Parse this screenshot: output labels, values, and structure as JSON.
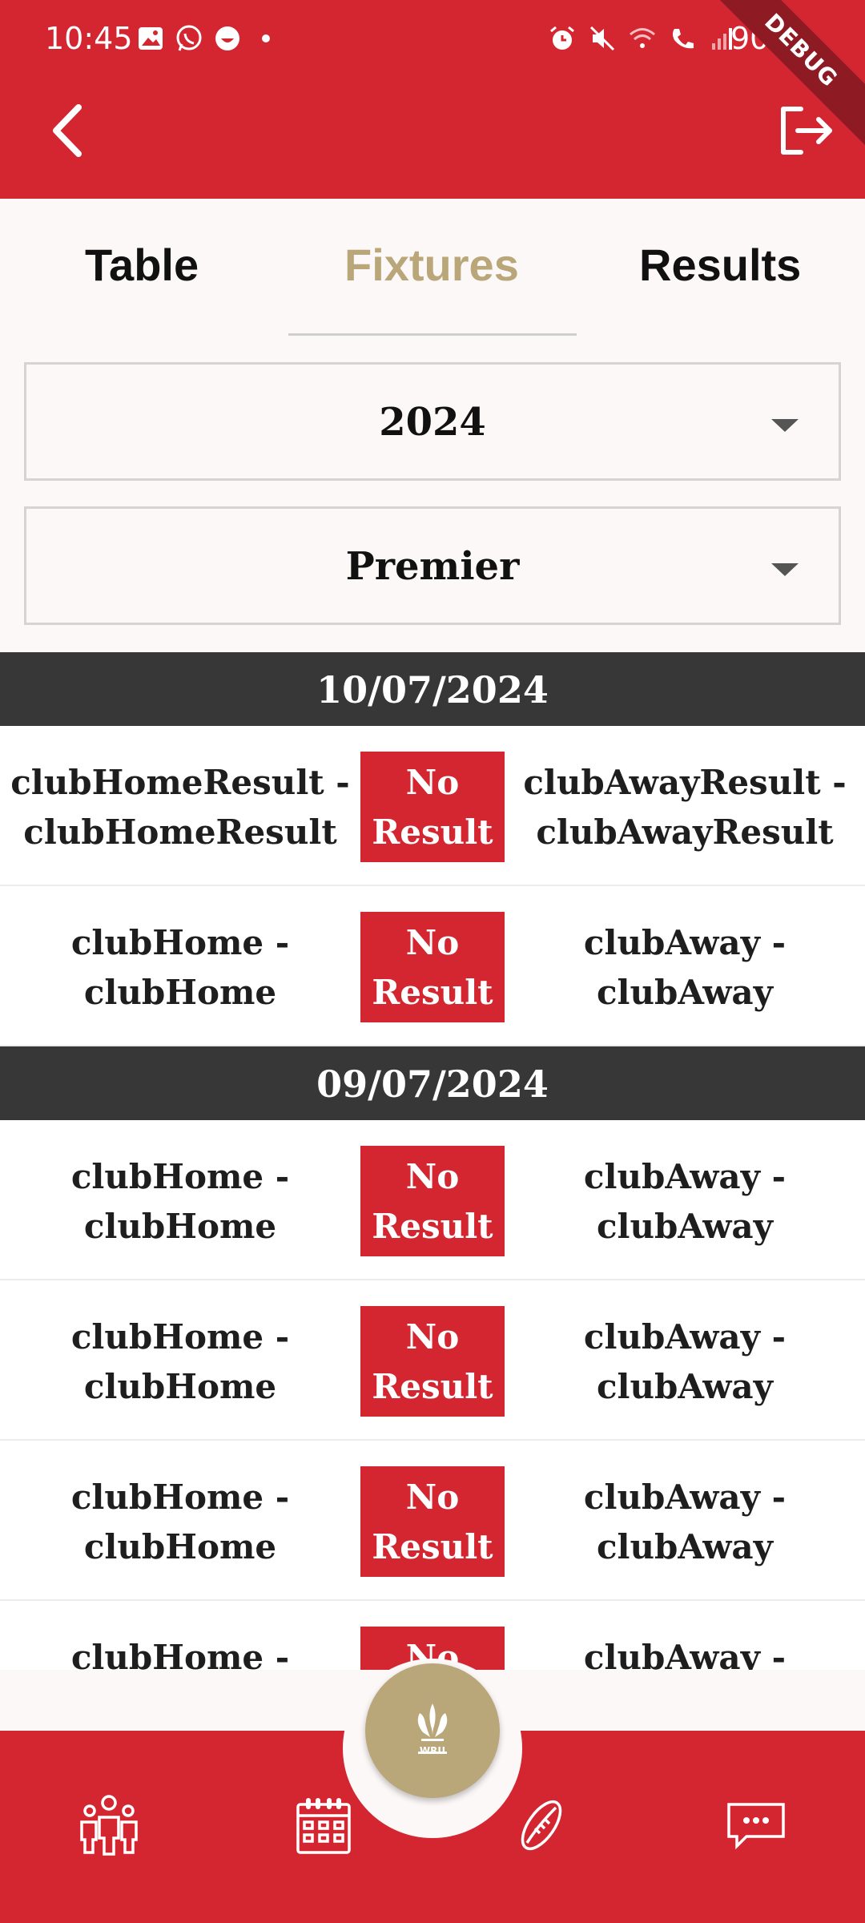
{
  "status_bar": {
    "time": "10:45",
    "battery": "90%",
    "debug_ribbon": "DEBUG",
    "left_icons": [
      "gallery-icon",
      "whatsapp-icon",
      "emoji-icon",
      "dot-icon"
    ],
    "right_icons": [
      "alarm-icon",
      "mute-icon",
      "wifi-icon",
      "wifi-call-icon",
      "signal-icon",
      "battery-icon"
    ]
  },
  "header": {
    "back_icon": "chevron-left-icon",
    "logout_icon": "logout-icon"
  },
  "tabs": [
    {
      "label": "Table",
      "active": false
    },
    {
      "label": "Fixtures",
      "active": true
    },
    {
      "label": "Results",
      "active": false
    }
  ],
  "filters": {
    "year": "2024",
    "league": "Premier"
  },
  "groups": [
    {
      "date": "10/07/2024",
      "matches": [
        {
          "home": "clubHomeResult - clubHomeResult",
          "status": "No Result",
          "away": "clubAwayResult - clubAwayResult"
        },
        {
          "home": "clubHome - clubHome",
          "status": "No Result",
          "away": "clubAway - clubAway"
        }
      ]
    },
    {
      "date": "09/07/2024",
      "matches": [
        {
          "home": "clubHome - clubHome",
          "status": "No Result",
          "away": "clubAway - clubAway"
        },
        {
          "home": "clubHome - clubHome",
          "status": "No Result",
          "away": "clubAway - clubAway"
        },
        {
          "home": "clubHome - clubHome",
          "status": "No Result",
          "away": "clubAway - clubAway"
        },
        {
          "home": "clubHome - clubHome",
          "status": "No Result",
          "away": "clubAway - clubAway"
        }
      ]
    }
  ],
  "bottom_nav": {
    "fab_label": "WRU",
    "items": [
      "people-icon",
      "calendar-icon",
      "rugby-ball-icon",
      "chat-icon"
    ]
  },
  "colors": {
    "brand_red": "#d32630",
    "gold": "#b9a679",
    "date_bar": "#373737",
    "background": "#fdf8f8"
  }
}
